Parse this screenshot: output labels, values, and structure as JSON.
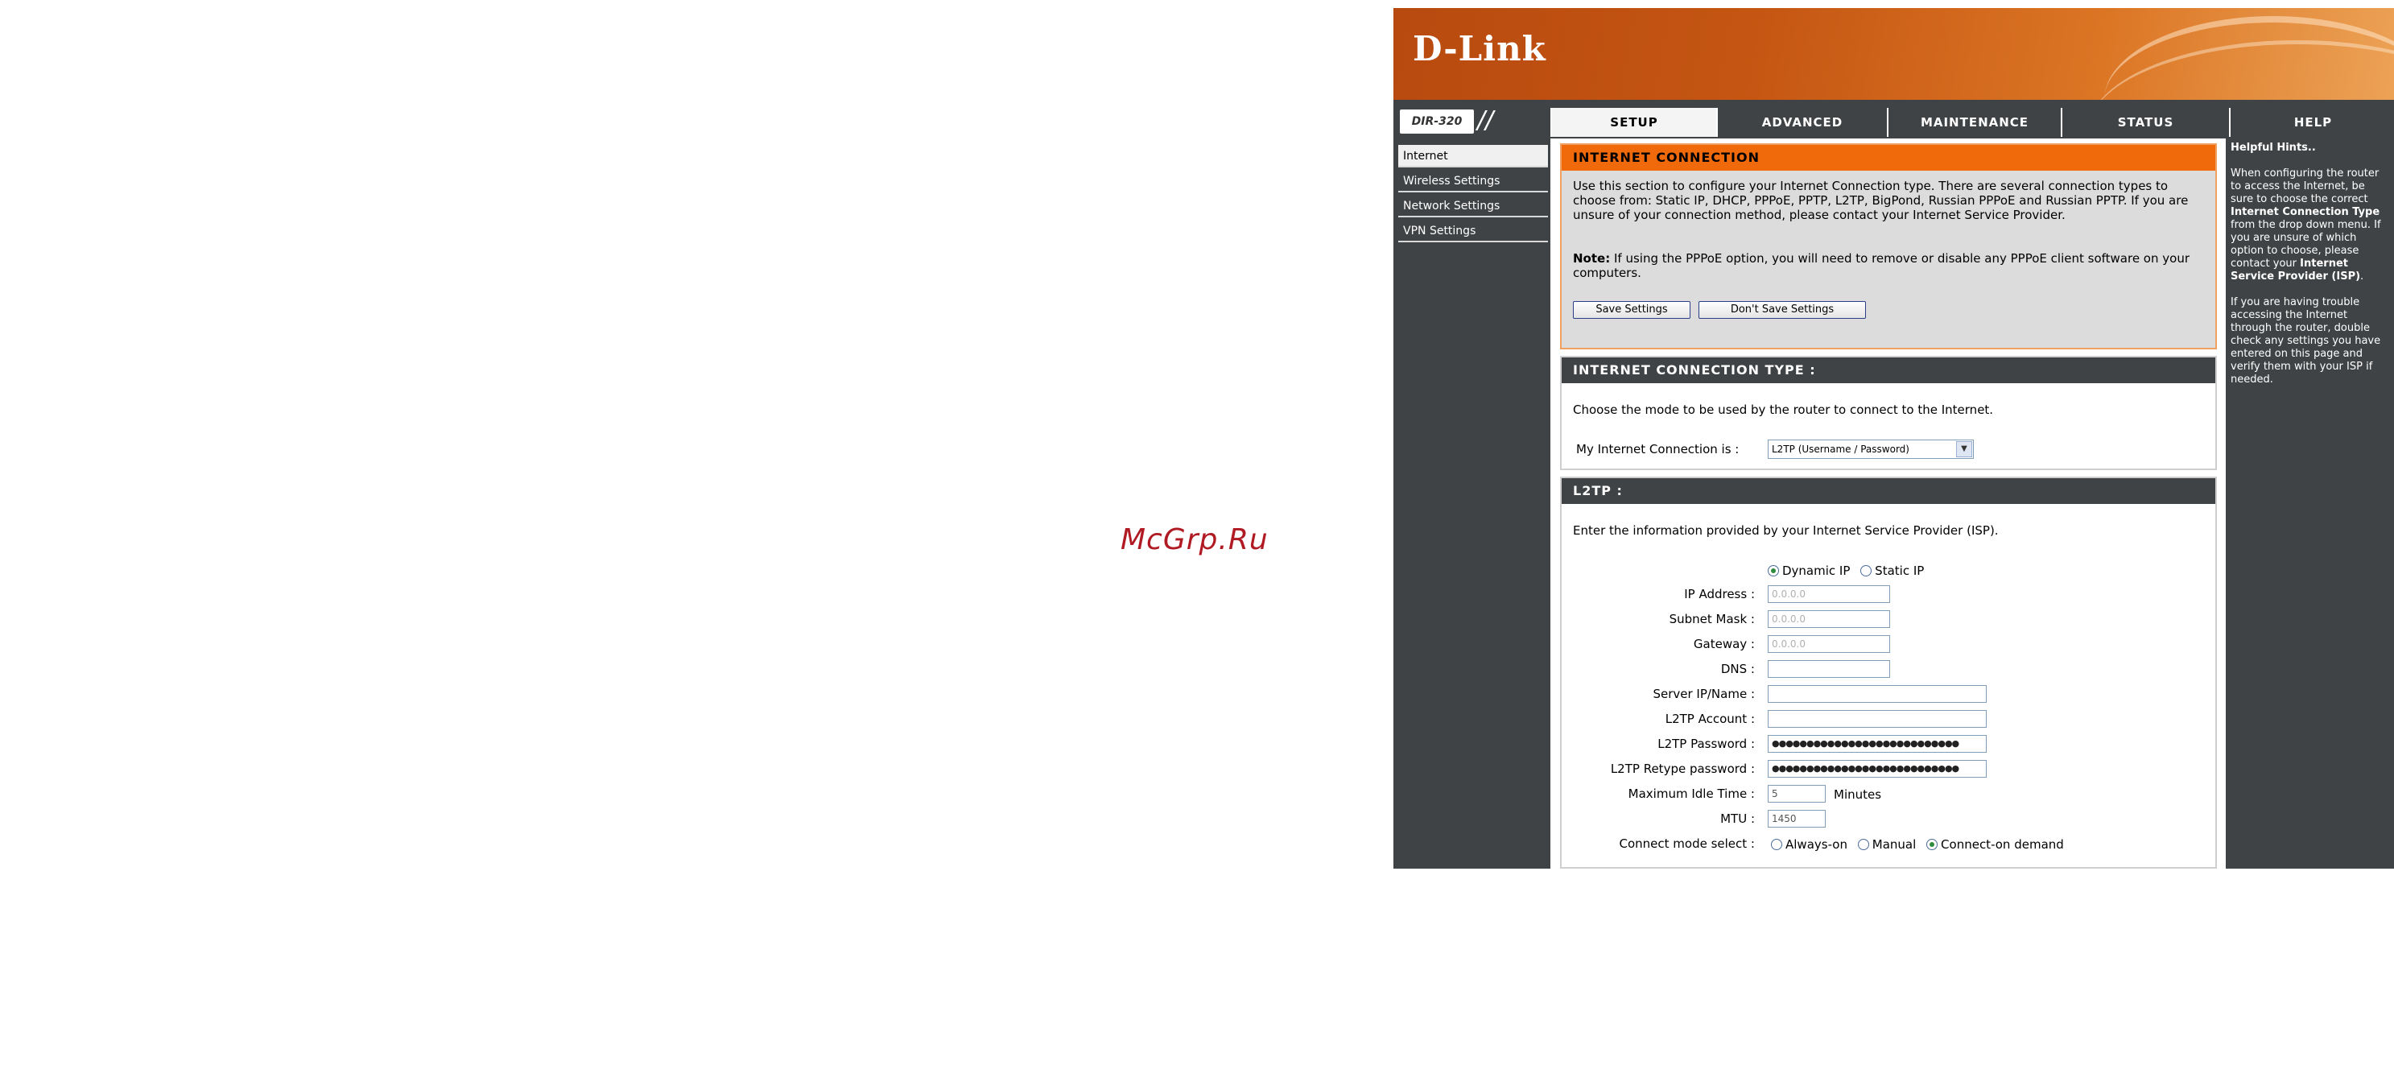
{
  "watermark": "McGrp.Ru",
  "header": {
    "logo": "D-Link",
    "model": "DIR-320"
  },
  "tabs": [
    {
      "label": "SETUP",
      "active": true
    },
    {
      "label": "ADVANCED",
      "active": false
    },
    {
      "label": "MAINTENANCE",
      "active": false
    },
    {
      "label": "STATUS",
      "active": false
    },
    {
      "label": "HELP",
      "active": false
    }
  ],
  "sidebar": {
    "items": [
      {
        "label": "Internet",
        "active": true
      },
      {
        "label": "Wireless Settings",
        "active": false
      },
      {
        "label": "Network Settings",
        "active": false
      },
      {
        "label": "VPN Settings",
        "active": false
      }
    ]
  },
  "internet_connection": {
    "title": "INTERNET CONNECTION",
    "description": "Use this section to configure your Internet Connection type. There are several connection types to choose from: Static IP, DHCP, PPPoE, PPTP, L2TP, BigPond, Russian PPPoE and Russian PPTP. If you are unsure of your connection method, please contact your Internet Service Provider.",
    "note_label": "Note:",
    "note_text": "If using the PPPoE option, you will need to remove or disable any PPPoE client software on your computers.",
    "save_button": "Save Settings",
    "dont_save_button": "Don't Save Settings"
  },
  "connection_type": {
    "title": "INTERNET CONNECTION TYPE :",
    "description": "Choose the mode to be used by the router to connect to the Internet.",
    "select_label": "My Internet Connection is :",
    "selected_value": "L2TP (Username / Password)"
  },
  "l2tp": {
    "title": "L2TP :",
    "description": "Enter the information provided by your Internet Service Provider (ISP).",
    "ip_mode": {
      "dynamic_label": "Dynamic IP",
      "static_label": "Static IP",
      "selected": "dynamic"
    },
    "fields": {
      "ip_address": {
        "label": "IP Address :",
        "value": "0.0.0.0"
      },
      "subnet_mask": {
        "label": "Subnet Mask :",
        "value": "0.0.0.0"
      },
      "gateway": {
        "label": "Gateway :",
        "value": "0.0.0.0"
      },
      "dns": {
        "label": "DNS :",
        "value": ""
      },
      "server": {
        "label": "Server IP/Name :",
        "value": ""
      },
      "account": {
        "label": "L2TP Account :",
        "value": ""
      },
      "password": {
        "label": "L2TP Password :",
        "value": "●●●●●●●●●●●●●●●●●●●●●●●●●●●"
      },
      "retype_password": {
        "label": "L2TP Retype password :",
        "value": "●●●●●●●●●●●●●●●●●●●●●●●●●●●"
      },
      "idle_time": {
        "label": "Maximum Idle Time :",
        "value": "5",
        "unit": "Minutes"
      },
      "mtu": {
        "label": "MTU :",
        "value": "1450"
      }
    },
    "connect_mode": {
      "label": "Connect mode select :",
      "options": [
        "Always-on",
        "Manual",
        "Connect-on demand"
      ],
      "selected": "Connect-on demand"
    }
  },
  "help": {
    "title": "Helpful Hints..",
    "para1_a": "When configuring the router to access the Internet, be sure to choose the correct ",
    "para1_b": "Internet Connection Type",
    "para1_c": " from the drop down menu. If you are unsure of which option to choose, please contact your ",
    "para1_d": "Internet Service Provider (ISP)",
    "para1_e": ".",
    "para2": "If you are having trouble accessing the Internet through the router, double check any settings you have entered on this page and verify them with your ISP if needed."
  }
}
